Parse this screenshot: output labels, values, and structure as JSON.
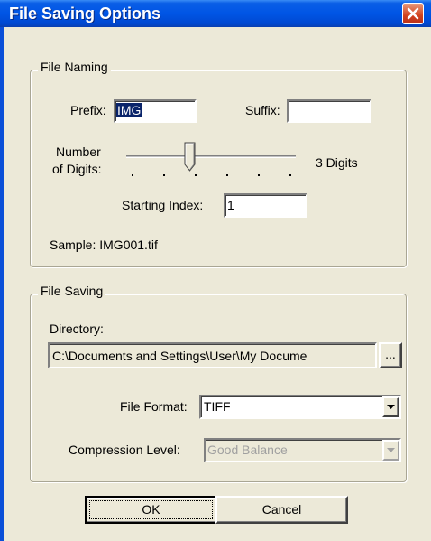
{
  "window": {
    "title": "File Saving Options",
    "close_icon": "close-icon"
  },
  "file_naming": {
    "legend": "File Naming",
    "prefix_label": "Prefix:",
    "prefix_value": "IMG",
    "suffix_label": "Suffix:",
    "suffix_value": "",
    "digits_label_line1": "Number",
    "digits_label_line2": "of Digits:",
    "digits_value_text": "3 Digits",
    "digits_slider": {
      "min": 1,
      "max": 6,
      "value": 3
    },
    "starting_index_label": "Starting Index:",
    "starting_index_value": "1",
    "sample_text": "Sample: IMG001.tif"
  },
  "file_saving": {
    "legend": "File Saving",
    "directory_label": "Directory:",
    "directory_value": "C:\\Documents and Settings\\User\\My Docume",
    "browse_label": "...",
    "file_format_label": "File Format:",
    "file_format_value": "TIFF",
    "compression_label": "Compression Level:",
    "compression_value": "Good Balance"
  },
  "buttons": {
    "ok": "OK",
    "cancel": "Cancel"
  },
  "colors": {
    "titlebar": "#0055e5",
    "dialog_bg": "#ece9d8",
    "selection": "#0a246a",
    "close": "#d2421d"
  }
}
